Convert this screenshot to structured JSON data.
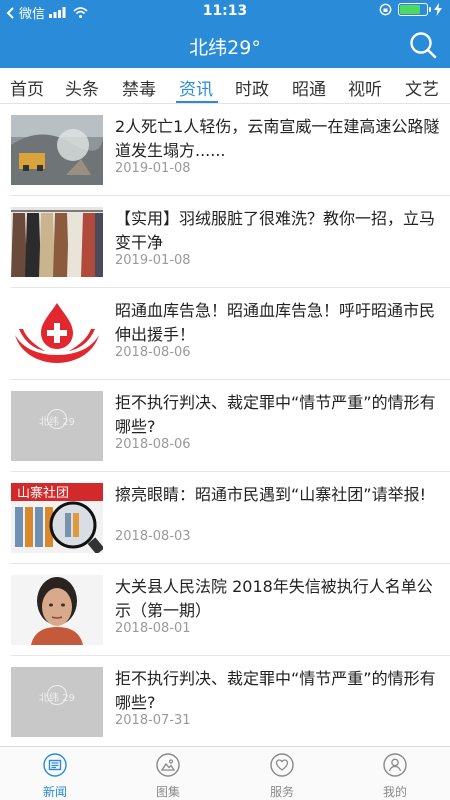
{
  "status_bar": {
    "carrier": "微信",
    "time": "11:13",
    "battery_level": 0.85,
    "battery_color": "#4cd964"
  },
  "header": {
    "title": "北纬29°",
    "search_icon": "search-icon",
    "background": "#2a8bd8"
  },
  "tabs": {
    "active_index": 3,
    "items": [
      "首页",
      "头条",
      "禁毒",
      "资讯",
      "时政",
      "昭通",
      "视听",
      "文艺"
    ]
  },
  "news": [
    {
      "title": "2人死亡1人轻伤，云南宣威一在建高速公路隧道发生塌方......",
      "date": "2019-01-08",
      "thumb": "tunnel-collapse-photo"
    },
    {
      "title": "【实用】羽绒服脏了很难洗？教你一招，立马变干净",
      "date": "2019-01-08",
      "thumb": "down-jackets-photo"
    },
    {
      "title": "昭通血库告急！昭通血库告急！呼吁昭通市民伸出援手！",
      "date": "2018-08-06",
      "thumb": "blood-donation-logo"
    },
    {
      "title": "拒不执行判决、裁定罪中“情节严重”的情形有哪些?",
      "date": "2018-08-06",
      "thumb": "placeholder-logo"
    },
    {
      "title": "擦亮眼睛：昭通市民遇到“山寨社团”请举报!",
      "date": "2018-08-03",
      "thumb": "fake-association-photo"
    },
    {
      "title": "大关县人民法院 2018年失信被执行人名单公示（第一期）",
      "date": "2018-08-01",
      "thumb": "portrait-photo"
    },
    {
      "title": "拒不执行判决、裁定罪中“情节严重”的情形有哪些?",
      "date": "2018-07-31",
      "thumb": "placeholder-logo"
    }
  ],
  "placeholder": {
    "logo_text": "北纬",
    "logo_number": "29"
  },
  "thumb_banner_text": "山寨社团",
  "bottom_tabs": {
    "active_index": 0,
    "items": [
      {
        "label": "新闻",
        "icon": "newspaper-icon"
      },
      {
        "label": "图集",
        "icon": "photo-icon"
      },
      {
        "label": "服务",
        "icon": "heart-icon"
      },
      {
        "label": "我的",
        "icon": "user-icon"
      }
    ]
  },
  "colors": {
    "accent": "#2a8bd8",
    "date": "#9a9a9a",
    "blood_red": "#e0282e"
  }
}
